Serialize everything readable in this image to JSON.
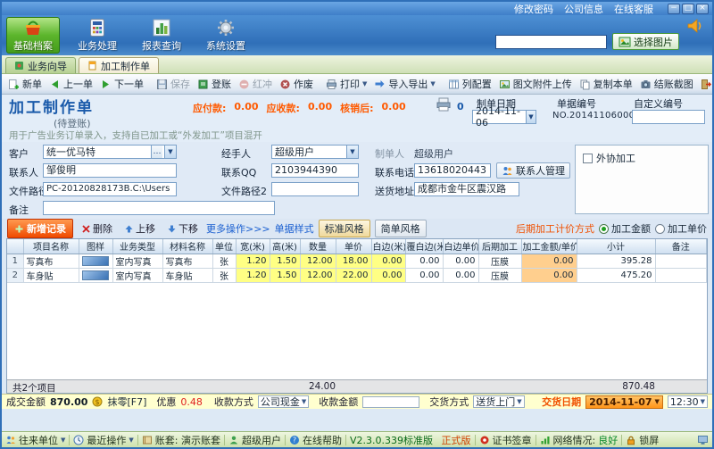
{
  "titlebar": {
    "links": [
      "修改密码",
      "公司信息",
      "在线客服"
    ],
    "minimize": "−",
    "maximize": "□",
    "close": "×"
  },
  "nav": {
    "items": [
      "基础档案",
      "业务处理",
      "报表查询",
      "系统设置"
    ],
    "image_input_value": "",
    "select_image": "选择图片"
  },
  "tabs": {
    "wizard": "业务向导",
    "order": "加工制作单"
  },
  "toolbar": {
    "new": "新单",
    "prev": "上一单",
    "next": "下一单",
    "save": "保存",
    "register": "登账",
    "redflush": "红冲",
    "void": "作废",
    "print": "打印",
    "import_export": "导入导出",
    "columns": "列配置",
    "attach": "图文附件上传",
    "copy": "复制本单",
    "screenshot": "结账截图",
    "exit": "退出"
  },
  "doc": {
    "title": "加工制作单",
    "status": "(待登账)",
    "payable_label": "应付款:",
    "payable": "0.00",
    "receivable_label": "应收款:",
    "receivable": "0.00",
    "writeoff_label": "核销后:",
    "writeoff": "0.00",
    "print_count": "0",
    "date_label": "制单日期",
    "date": "2014-11-06",
    "no_label": "单据编号",
    "no": "NO.201411060001",
    "custom_label": "自定义编号",
    "custom": "",
    "desc": "用于广告业务订单录入，支持自已加工或“外发加工”项目混开"
  },
  "form": {
    "customer_label": "客户",
    "customer": "统一优马特",
    "handler_label": "经手人",
    "handler": "超级用户",
    "maker_label": "制单人",
    "maker": "超级用户",
    "contact_label": "联系人",
    "contact": "邹俊明",
    "qq_label": "联系QQ",
    "qq": "2103944390",
    "phone_label": "联系电话",
    "phone": "13618020443",
    "contact_mgr": "联系人管理",
    "path_label": "文件路径",
    "path": "PC-20120828173B.C:\\Users",
    "path2_label": "文件路径2",
    "path2": "",
    "addr_label": "送货地址",
    "addr": "成都市金牛区震汉路",
    "remark_label": "备注",
    "remark": "",
    "outsource": "外协加工"
  },
  "grid": {
    "add": "新增记录",
    "del": "删除",
    "up": "上移",
    "down": "下移",
    "more": "更多操作>>>",
    "style": "单据样式",
    "standard": "标准风格",
    "simple": "简单风格",
    "pricing_label": "后期加工计价方式",
    "radio_amount": "加工金额",
    "radio_unit": "加工单价"
  },
  "table": {
    "columns": [
      "",
      "项目名称",
      "图样",
      "业务类型",
      "材料名称",
      "单位",
      "宽(米)",
      "高(米)",
      "数量",
      "单价",
      "白边(米)",
      "覆白边(米)",
      "白边单价",
      "后期加工",
      "加工金额/单价",
      "小计",
      "备注"
    ],
    "rows": [
      [
        "1",
        "写真布",
        "",
        "室内写真",
        "写真布",
        "张",
        "1.20",
        "1.50",
        "12.00",
        "18.00",
        "0.00",
        "0.00",
        "0.00",
        "压膜",
        "0.00",
        "395.28",
        ""
      ],
      [
        "2",
        "车身贴",
        "",
        "室内写真",
        "车身贴",
        "张",
        "1.20",
        "1.50",
        "12.00",
        "22.00",
        "0.00",
        "0.00",
        "0.00",
        "压膜",
        "0.00",
        "475.20",
        ""
      ]
    ],
    "footer_count": "共2个项目",
    "footer_qty": "24.00",
    "footer_total": "870.48"
  },
  "payment": {
    "deal_label": "成交金额",
    "deal": "870.00",
    "round": "抹零[F7]",
    "discount_label": "优惠",
    "discount": "0.48",
    "method_label": "收款方式",
    "method": "公司现金",
    "amount_label": "收款金额",
    "amount": "",
    "delivery_label": "交货方式",
    "delivery": "送货上门",
    "date_label": "交货日期",
    "date": "2014-11-07",
    "time": "12:30"
  },
  "statusbar": {
    "partners": "往来单位",
    "recent": "最近操作",
    "account": "账套: 演示账套",
    "user": "超级用户",
    "help": "在线帮助",
    "version": "V2.3.0.339标准版",
    "edition": "正式版",
    "cert": "证书签章",
    "network_label": "网络情况:",
    "network": "良好",
    "lock": "锁屏"
  }
}
